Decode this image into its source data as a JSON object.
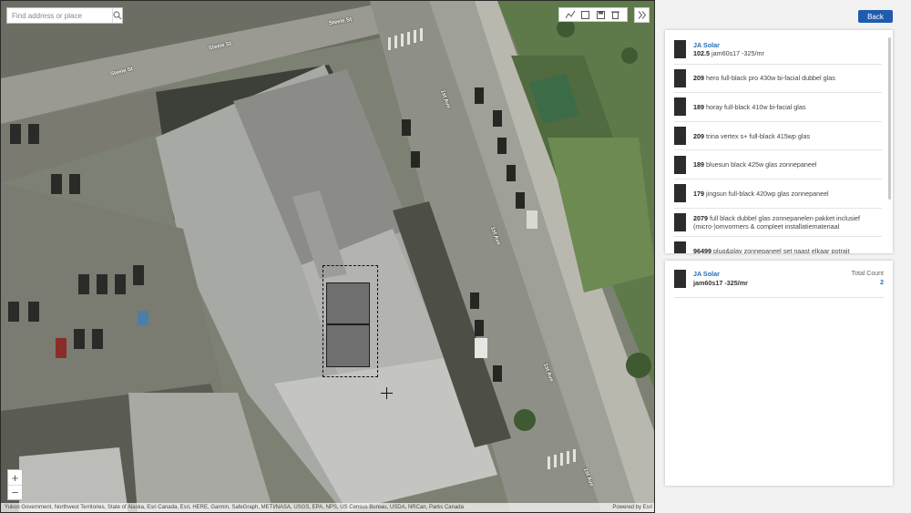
{
  "map": {
    "search": {
      "placeholder": "Find address or place",
      "icon": "search-icon"
    },
    "tools": [
      "polyline-icon",
      "square-icon",
      "save-icon",
      "trash-icon"
    ],
    "expand_icon": "double-chevron-right-icon",
    "zoom": {
      "in": "+",
      "out": "−"
    },
    "road_labels": {
      "steele_st_1": "Steele St",
      "steele_st_2": "Steele St",
      "steele_st_3": "Steele St",
      "av_1": "1st Ave",
      "av_2": "1st Ave",
      "av_3": "1st Ave",
      "av_4": "1st Ave"
    },
    "attribution": {
      "left": "Yukon Government, Northwest Territories, State of Alaska, Esri Canada, Esri, HERE, Garmin, SafeGraph, METI/NASA, USGS, EPA, NPS, US Census Bureau, USDA, NRCan, Parks Canada",
      "right": "Powered by Esri"
    }
  },
  "back_label": "Back",
  "panel_list": [
    {
      "brand": "JA Solar",
      "count": "102.5",
      "name": "jam60s17 -325/mr"
    },
    {
      "brand": "",
      "count": "209",
      "name": "hero full-black pro 430w bi-facial dubbel glas"
    },
    {
      "brand": "",
      "count": "189",
      "name": "horay full-black 410w bi-facial glas"
    },
    {
      "brand": "",
      "count": "209",
      "name": "trina vertex s+ full-black 415wp glas"
    },
    {
      "brand": "",
      "count": "189",
      "name": "bluesun black 425w glas zonnepaneel"
    },
    {
      "brand": "",
      "count": "179",
      "name": "jingsun full-black 420wp glas zonnepaneel"
    },
    {
      "brand": "",
      "count": "2079",
      "name": "full black dubbel glas zonnepanelen pakket inclusief (micro-)omvormers & compleet installatiemateriaal"
    },
    {
      "brand": "",
      "count": "96499",
      "name": "plug&play zonnepaneel set naast elkaar potrait"
    }
  ],
  "selected": {
    "brand": "JA Solar",
    "model": "jam60s17 -325/mr",
    "count_label": "Total Count",
    "count": "2"
  },
  "colors": {
    "accent": "#1f5cb0",
    "link": "#1f6fb8",
    "panel_fill": "#6f6f6f"
  }
}
